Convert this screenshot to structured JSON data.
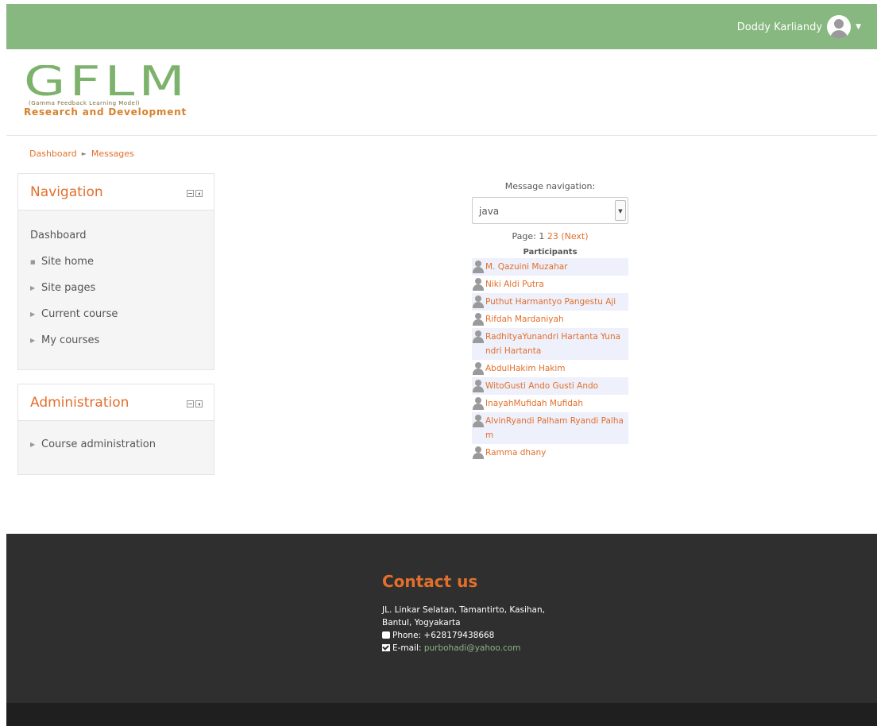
{
  "navbar": {
    "user_name": "Doddy Karliandy"
  },
  "logo": {
    "letters": "GFLM",
    "subtitle": "(Gamma Feedback Learning Model)",
    "tagline": "Research and Development"
  },
  "breadcrumb": {
    "items": [
      "Dashboard",
      "Messages"
    ]
  },
  "navigation_block": {
    "title": "Navigation",
    "root": "Dashboard",
    "items": [
      "Site home",
      "Site pages",
      "Current course",
      "My courses"
    ]
  },
  "administration_block": {
    "title": "Administration",
    "items": [
      "Course administration"
    ]
  },
  "message_nav": {
    "label": "Message navigation:",
    "selected": "java",
    "pager": {
      "prefix": "Page:",
      "current": "1",
      "page2": "2",
      "page3": "3",
      "next": "(Next)"
    },
    "participants_title": "Participants",
    "participants": [
      "M. Qazuini Muzahar",
      "Niki Aldi Putra",
      "Puthut Harmantyo Pangestu Aji",
      "Rifdah Mardaniyah",
      "RadhityaYunandri Hartanta Yunandri Hartanta",
      "AbdulHakim Hakim",
      "WitoGusti Ando Gusti Ando",
      "InayahMufidah Mufidah",
      "AlvinRyandi Palham Ryandi Palham",
      "Ramma dhany"
    ]
  },
  "footer": {
    "title": "Contact us",
    "address_line1": "JL. Linkar Selatan, Tamantirto, Kasihan,",
    "address_line2": "Bantul, Yogyakarta",
    "phone": "Phone: +628179438668",
    "email_label": "E-mail:",
    "email": "purbohadi@yahoo.com"
  },
  "colors": {
    "navbar": "#87b87f",
    "accent": "#e26f2c",
    "footer": "#2f2f2f"
  }
}
